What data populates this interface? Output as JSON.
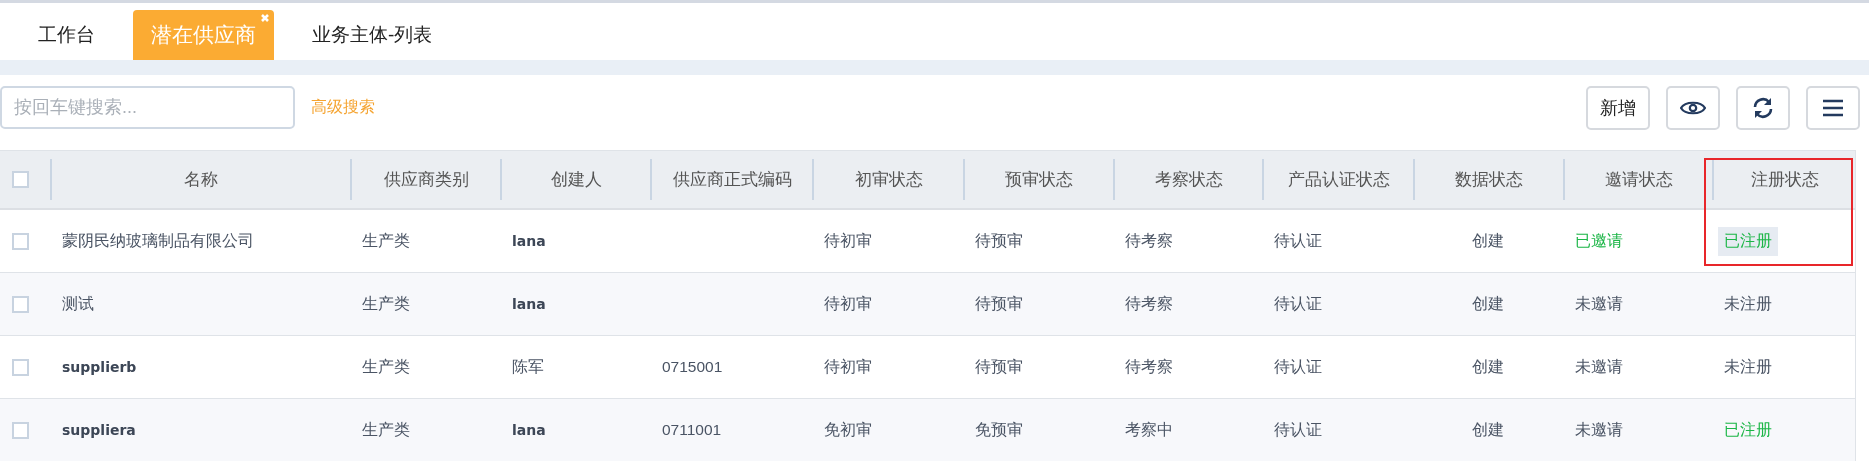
{
  "tabs": [
    {
      "label": "工作台",
      "selected": false,
      "closable": false
    },
    {
      "label": "潜在供应商",
      "selected": true,
      "closable": true
    },
    {
      "label": "业务主体-列表",
      "selected": false,
      "closable": false
    }
  ],
  "search": {
    "placeholder": "按回车键搜索..."
  },
  "advanced_search": "高级搜索",
  "toolbar": [
    {
      "kind": "text",
      "label": "新增"
    },
    {
      "kind": "eye"
    },
    {
      "kind": "refresh"
    },
    {
      "kind": "menu"
    }
  ],
  "table": {
    "header_checked": false,
    "columns": [
      {
        "label": "名称",
        "outlined": false
      },
      {
        "label": "供应商类别",
        "outlined": false
      },
      {
        "label": "创建人",
        "outlined": false
      },
      {
        "label": "供应商正式编码",
        "outlined": false
      },
      {
        "label": "初审状态",
        "outlined": false
      },
      {
        "label": "预审状态",
        "outlined": false
      },
      {
        "label": "考察状态",
        "outlined": false
      },
      {
        "label": "产品认证状态",
        "outlined": false
      },
      {
        "label": "数据状态",
        "outlined": false
      },
      {
        "label": "邀请状态",
        "outlined": false
      },
      {
        "label": "注册状态",
        "outlined": true
      }
    ],
    "rows": [
      {
        "checked": false,
        "cells": [
          {
            "text": "蒙阴民纳玻璃制品有限公司"
          },
          {
            "text": "生产类"
          },
          {
            "text": "lana"
          },
          {
            "text": ""
          },
          {
            "text": "待初审"
          },
          {
            "text": "待预审"
          },
          {
            "text": "待考察"
          },
          {
            "text": "待认证"
          },
          {
            "text": "创建"
          },
          {
            "text": "已邀请",
            "green": true
          },
          {
            "text": "已注册",
            "green": true,
            "shaded": true
          }
        ]
      },
      {
        "checked": false,
        "cells": [
          {
            "text": "测试"
          },
          {
            "text": "生产类"
          },
          {
            "text": "lana"
          },
          {
            "text": ""
          },
          {
            "text": "待初审"
          },
          {
            "text": "待预审"
          },
          {
            "text": "待考察"
          },
          {
            "text": "待认证"
          },
          {
            "text": "创建"
          },
          {
            "text": "未邀请",
            "green": false
          },
          {
            "text": "未注册",
            "green": false,
            "shaded": false
          }
        ]
      },
      {
        "checked": false,
        "cells": [
          {
            "text": "supplierb"
          },
          {
            "text": "生产类"
          },
          {
            "text": "陈军"
          },
          {
            "text": "0715001"
          },
          {
            "text": "待初审"
          },
          {
            "text": "待预审"
          },
          {
            "text": "待考察"
          },
          {
            "text": "待认证"
          },
          {
            "text": "创建"
          },
          {
            "text": "未邀请",
            "green": false
          },
          {
            "text": "未注册",
            "green": false,
            "shaded": false
          }
        ]
      },
      {
        "checked": false,
        "cells": [
          {
            "text": "suppliera"
          },
          {
            "text": "生产类"
          },
          {
            "text": "lana"
          },
          {
            "text": "0711001"
          },
          {
            "text": "免初审"
          },
          {
            "text": "免预审"
          },
          {
            "text": "考察中"
          },
          {
            "text": "待认证"
          },
          {
            "text": "创建"
          },
          {
            "text": "未邀请",
            "green": false
          },
          {
            "text": "已注册",
            "green": true,
            "shaded": false
          }
        ]
      }
    ]
  }
}
